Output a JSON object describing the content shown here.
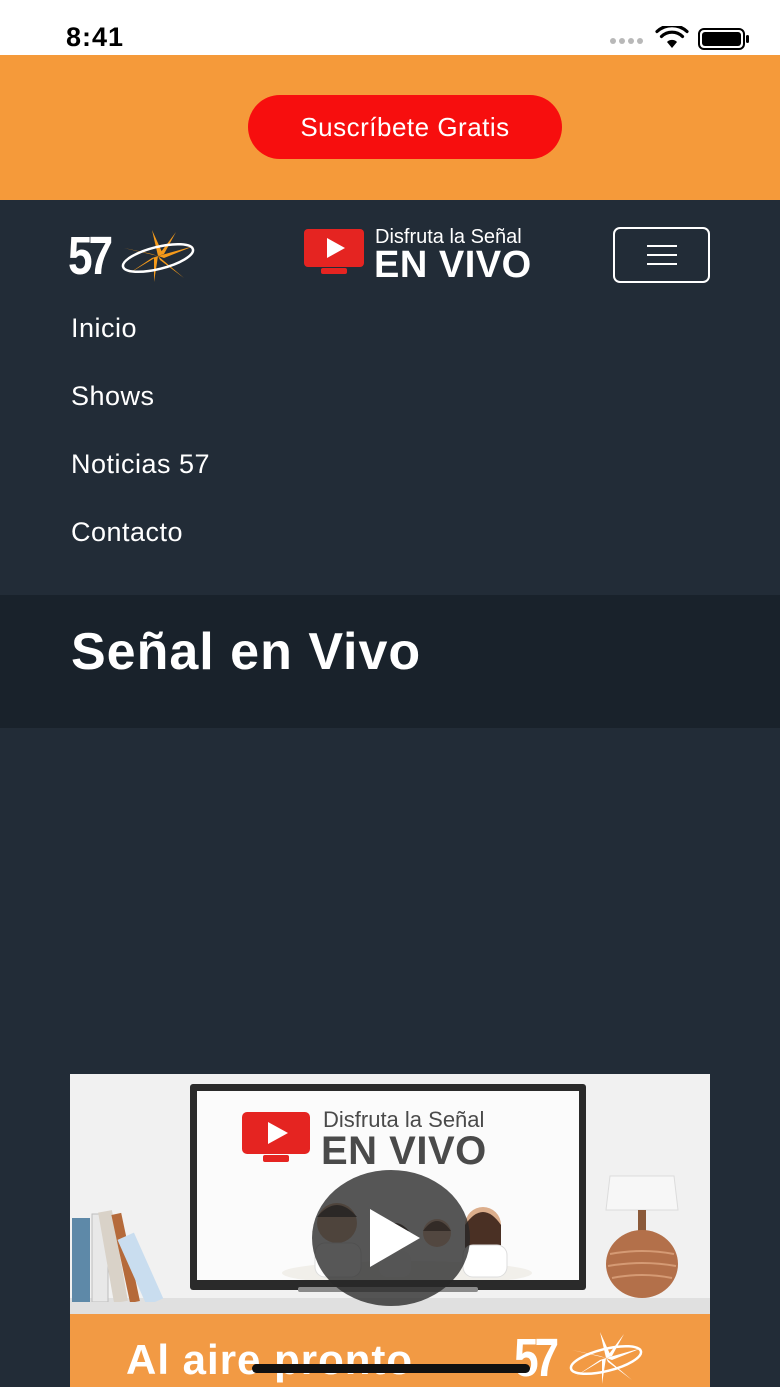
{
  "status_bar": {
    "time": "8:41"
  },
  "promo": {
    "subscribe_label": "Suscríbete Gratis"
  },
  "header": {
    "logo_text": "57",
    "live_promo": {
      "line1": "Disfruta la Señal",
      "line2": "EN VIVO"
    }
  },
  "nav": {
    "items": [
      {
        "label": "Inicio"
      },
      {
        "label": "Shows"
      },
      {
        "label": "Noticias 57"
      },
      {
        "label": "Contacto"
      }
    ]
  },
  "page": {
    "title": "Señal en Vivo"
  },
  "video": {
    "tv_line1": "Disfruta la Señal",
    "tv_line2": "EN VIVO",
    "footer_text": "Al aire pronto",
    "footer_logo": "57"
  },
  "colors": {
    "promo_bg": "#f59a3a",
    "subscribe_button": "#f70e0e",
    "header_bg": "#222c37",
    "title_band_bg": "#19222b",
    "accent_red": "#e52421"
  },
  "icons": [
    "wifi-icon",
    "battery-icon",
    "play-icon",
    "menu-icon",
    "tv-icon",
    "star-icon"
  ]
}
